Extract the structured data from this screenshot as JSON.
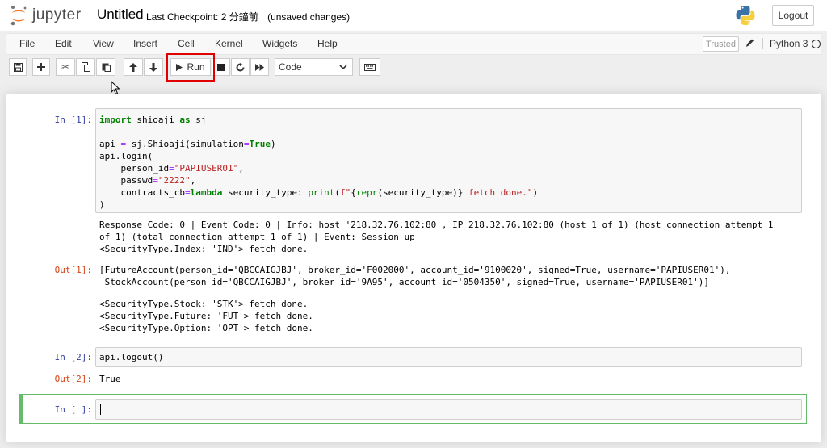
{
  "header": {
    "logo_text": "jupyter",
    "notebook_title": "Untitled",
    "checkpoint": "Last Checkpoint: 2 分鐘前",
    "unsaved": "(unsaved changes)",
    "logout_label": "Logout"
  },
  "menu": {
    "items": [
      "File",
      "Edit",
      "View",
      "Insert",
      "Cell",
      "Kernel",
      "Widgets",
      "Help"
    ],
    "trusted_label": "Trusted",
    "kernel_name": "Python 3"
  },
  "toolbar": {
    "run_label": "Run",
    "cell_type": "Code",
    "cell_type_options": [
      "Code"
    ]
  },
  "cells": [
    {
      "prompt_in": "In [1]:",
      "code_lines": [
        "import shioaji as sj",
        "",
        "api = sj.Shioaji(simulation=True)",
        "api.login(",
        "    person_id=\"PAPIUSER01\",",
        "    passwd=\"2222\",",
        "    contracts_cb=lambda security_type: print(f\"{repr(security_type)} fetch done.\")",
        ")"
      ],
      "stdout_lines": [
        "Response Code: 0 | Event Code: 0 | Info: host '218.32.76.102:80', IP 218.32.76.102:80 (host 1 of 1) (host connection attempt 1",
        "of 1) (total connection attempt 1 of 1) | Event: Session up",
        "<SecurityType.Index: 'IND'> fetch done."
      ],
      "prompt_out": "Out[1]:",
      "result_lines": [
        "[FutureAccount(person_id='QBCCAIGJBJ', broker_id='F002000', account_id='9100020', signed=True, username='PAPIUSER01'),",
        " StockAccount(person_id='QBCCAIGJBJ', broker_id='9A95', account_id='0504350', signed=True, username='PAPIUSER01')]"
      ],
      "stdout2_lines": [
        "<SecurityType.Stock: 'STK'> fetch done.",
        "<SecurityType.Future: 'FUT'> fetch done.",
        "<SecurityType.Option: 'OPT'> fetch done."
      ]
    },
    {
      "prompt_in": "In [2]:",
      "code": "api.logout()",
      "prompt_out": "Out[2]:",
      "result": "True"
    },
    {
      "prompt_in": "In [ ]:",
      "code": ""
    }
  ],
  "colors": {
    "prompt_in": "#303f9f",
    "prompt_out": "#d84315",
    "keyword": "#008000",
    "string": "#ba2121",
    "edit_border": "#66bb6a",
    "highlight_box": "#e00000"
  }
}
